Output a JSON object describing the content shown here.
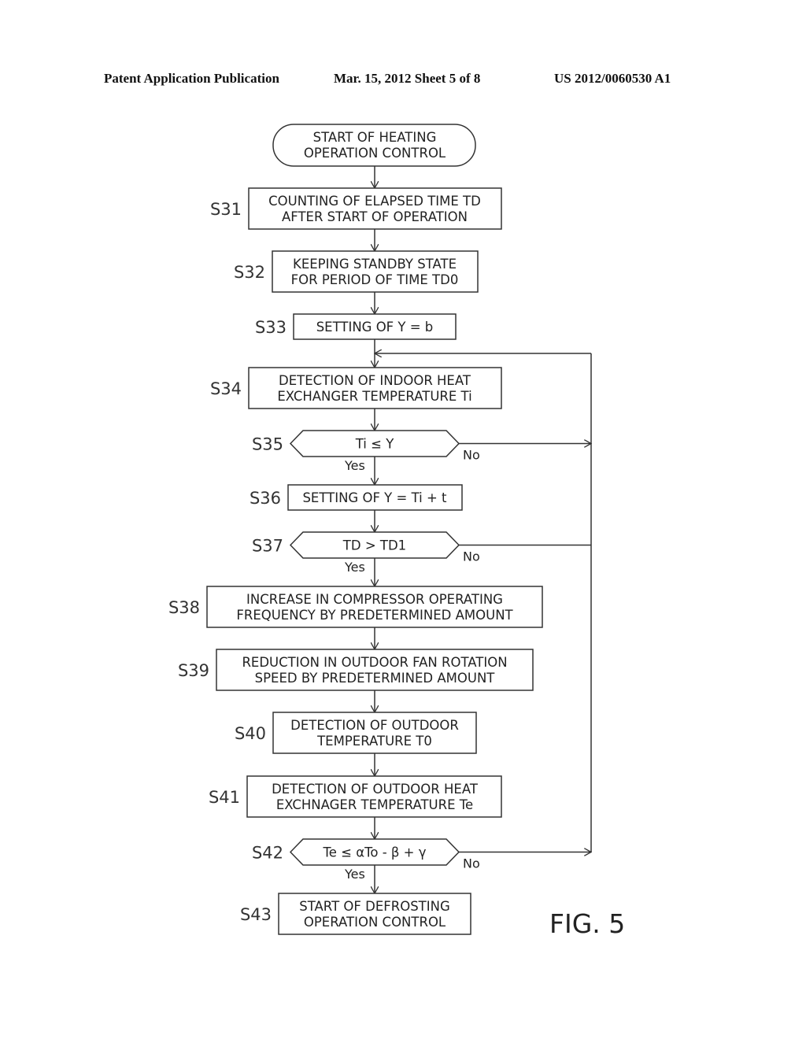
{
  "header": {
    "left": "Patent Application Publication",
    "middle": "Mar. 15, 2012  Sheet 5 of 8",
    "right": "US 2012/0060530 A1"
  },
  "figure_label": "FIG. 5",
  "flowchart": {
    "start": {
      "lines": [
        "START OF HEATING",
        "OPERATION CONTROL"
      ]
    },
    "steps": [
      {
        "id": "S31",
        "type": "process",
        "lines": [
          "COUNTING OF ELAPSED TIME TD",
          "AFTER START OF OPERATION"
        ]
      },
      {
        "id": "S32",
        "type": "process",
        "lines": [
          "KEEPING STANDBY STATE",
          "FOR PERIOD OF TIME TD0"
        ]
      },
      {
        "id": "S33",
        "type": "process",
        "lines": [
          "SETTING OF Y = b"
        ]
      },
      {
        "id": "S34",
        "type": "process",
        "lines": [
          "DETECTION OF INDOOR HEAT",
          "EXCHANGER TEMPERATURE Ti"
        ]
      },
      {
        "id": "S35",
        "type": "decision",
        "lines": [
          "Ti ≤ Y"
        ],
        "yes": "Yes",
        "no": "No"
      },
      {
        "id": "S36",
        "type": "process",
        "lines": [
          "SETTING OF Y = Ti + t"
        ]
      },
      {
        "id": "S37",
        "type": "decision",
        "lines": [
          "TD > TD1"
        ],
        "yes": "Yes",
        "no": "No"
      },
      {
        "id": "S38",
        "type": "process",
        "lines": [
          "INCREASE IN COMPRESSOR OPERATING",
          "FREQUENCY BY PREDETERMINED AMOUNT"
        ]
      },
      {
        "id": "S39",
        "type": "process",
        "lines": [
          "REDUCTION IN OUTDOOR FAN ROTATION",
          "SPEED BY PREDETERMINED AMOUNT"
        ]
      },
      {
        "id": "S40",
        "type": "process",
        "lines": [
          "DETECTION OF OUTDOOR",
          "TEMPERATURE T0"
        ]
      },
      {
        "id": "S41",
        "type": "process",
        "lines": [
          "DETECTION OF OUTDOOR HEAT",
          "EXCHNAGER TEMPERATURE Te"
        ]
      },
      {
        "id": "S42",
        "type": "decision",
        "lines": [
          "Te ≤ αTo - β + γ"
        ],
        "yes": "Yes",
        "no": "No"
      },
      {
        "id": "S43",
        "type": "process",
        "lines": [
          "START OF DEFROSTING",
          "OPERATION CONTROL"
        ]
      }
    ]
  }
}
